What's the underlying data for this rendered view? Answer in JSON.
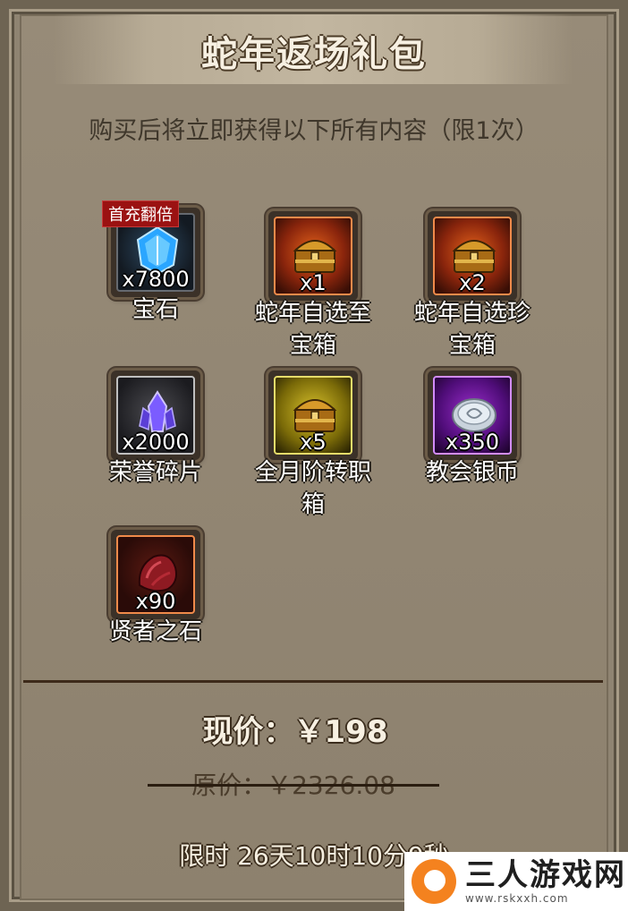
{
  "header": {
    "title": "蛇年返场礼包",
    "subtitle": "购买后将立即获得以下所有内容（限1次）"
  },
  "items": [
    {
      "qty": "x7800",
      "name": "宝石",
      "badge": "首充翻倍",
      "frame": "blue",
      "icon": "blue-gem-icon"
    },
    {
      "qty": "x1",
      "name": "蛇年自选至宝箱",
      "frame": "orange",
      "icon": "gold-chest-icon"
    },
    {
      "qty": "x2",
      "name": "蛇年自选珍宝箱",
      "frame": "orange",
      "icon": "gold-chest-icon"
    },
    {
      "qty": "x2000",
      "name": "荣誉碎片",
      "frame": "gray",
      "icon": "purple-crystal-icon"
    },
    {
      "qty": "x5",
      "name": "全月阶转职箱",
      "frame": "yellow",
      "icon": "gold-chest-icon"
    },
    {
      "qty": "x350",
      "name": "教会银币",
      "frame": "purple",
      "icon": "silver-coin-icon"
    },
    {
      "qty": "x90",
      "name": "贤者之石",
      "frame": "redorange",
      "icon": "red-stone-icon"
    }
  ],
  "price": {
    "current": "现价：￥198",
    "original": "原价：￥2326.08"
  },
  "timer": "限时 26天10时10分9秒",
  "watermark": {
    "name": "三人游戏网",
    "url": "www.rskxxh.com"
  },
  "colors": {
    "panel": "#8f8472",
    "badge": "#9b1212",
    "divider": "#3d2a1a"
  }
}
